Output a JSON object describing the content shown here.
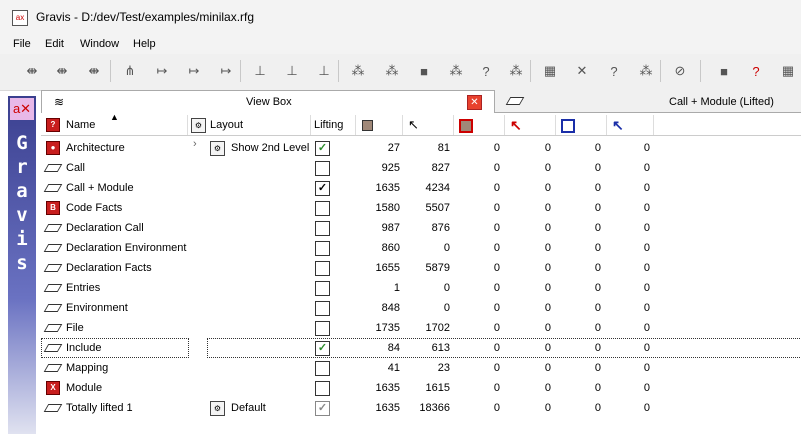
{
  "window": {
    "title": "Gravis - D:/dev/Test/examples/minilax.rfg",
    "app_icon": "ax"
  },
  "menu": [
    "File",
    "Edit",
    "Window",
    "Help"
  ],
  "toolbar_icons": [
    "node-layout-icon",
    "node-layout-icon",
    "node-layout-icon",
    "tree-icon",
    "edge-icon",
    "edge-icon",
    "edge-icon",
    "hierarchy-icon",
    "hierarchy-icon",
    "hierarchy-icon",
    "graph-icon",
    "graph-icon",
    "square-icon",
    "graph-icon",
    "query-icon",
    "graph-icon",
    "grid-icon",
    "cross-icon",
    "query-icon",
    "graph-icon",
    "no-icon",
    "square-icon",
    "query-red-icon",
    "grid-icon"
  ],
  "sidebar": {
    "logo": "a✕",
    "letters": [
      "G",
      "r",
      "a",
      "v",
      "i",
      "s"
    ]
  },
  "tabs": [
    {
      "label": "View Box",
      "icon": "stack-icon",
      "active": true
    },
    {
      "label": "Call + Module (Lifted)",
      "icon": "parallelogram-icon",
      "active": false
    }
  ],
  "columns": {
    "name": "Name",
    "layout": "Layout",
    "lifting": "Lifting"
  },
  "rows": [
    {
      "name": "Architecture",
      "icon": "red-balloon-icon",
      "expandable": true,
      "layout": "Show 2nd Level",
      "lifting": "green",
      "v": [
        "27",
        "81",
        "0",
        "0",
        "0",
        "0"
      ]
    },
    {
      "name": "Call",
      "icon": "parallelogram-icon",
      "layout": "",
      "lifting": "none",
      "v": [
        "925",
        "827",
        "0",
        "0",
        "0",
        "0"
      ]
    },
    {
      "name": "Call + Module",
      "icon": "parallelogram-icon",
      "layout": "",
      "lifting": "check",
      "v": [
        "1635",
        "4234",
        "0",
        "0",
        "0",
        "0"
      ]
    },
    {
      "name": "Code Facts",
      "icon": "red-b-icon",
      "layout": "",
      "lifting": "none",
      "v": [
        "1580",
        "5507",
        "0",
        "0",
        "0",
        "0"
      ]
    },
    {
      "name": "Declaration Call",
      "icon": "parallelogram-icon",
      "layout": "",
      "lifting": "none",
      "v": [
        "987",
        "876",
        "0",
        "0",
        "0",
        "0"
      ]
    },
    {
      "name": "Declaration Environment",
      "icon": "parallelogram-icon",
      "layout": "",
      "lifting": "none",
      "v": [
        "860",
        "0",
        "0",
        "0",
        "0",
        "0"
      ]
    },
    {
      "name": "Declaration Facts",
      "icon": "parallelogram-icon",
      "layout": "",
      "lifting": "none",
      "v": [
        "1655",
        "5879",
        "0",
        "0",
        "0",
        "0"
      ]
    },
    {
      "name": "Entries",
      "icon": "parallelogram-icon",
      "layout": "",
      "lifting": "none",
      "v": [
        "1",
        "0",
        "0",
        "0",
        "0",
        "0"
      ]
    },
    {
      "name": "Environment",
      "icon": "parallelogram-icon",
      "layout": "",
      "lifting": "none",
      "v": [
        "848",
        "0",
        "0",
        "0",
        "0",
        "0"
      ]
    },
    {
      "name": "File",
      "icon": "parallelogram-icon",
      "layout": "",
      "lifting": "none",
      "v": [
        "1735",
        "1702",
        "0",
        "0",
        "0",
        "0"
      ]
    },
    {
      "name": "Include",
      "icon": "parallelogram-icon",
      "layout": "",
      "lifting": "green",
      "selected": true,
      "v": [
        "84",
        "613",
        "0",
        "0",
        "0",
        "0"
      ]
    },
    {
      "name": "Mapping",
      "icon": "parallelogram-icon",
      "layout": "",
      "lifting": "none",
      "v": [
        "41",
        "23",
        "0",
        "0",
        "0",
        "0"
      ]
    },
    {
      "name": "Module",
      "icon": "red-x-icon",
      "layout": "",
      "lifting": "none",
      "v": [
        "1635",
        "1615",
        "0",
        "0",
        "0",
        "0"
      ]
    },
    {
      "name": "Totally lifted 1",
      "icon": "parallelogram-icon",
      "layout": "Default",
      "lifting": "grey",
      "v": [
        "1635",
        "18366",
        "0",
        "0",
        "0",
        "0"
      ]
    }
  ],
  "check_glyph": "✓"
}
